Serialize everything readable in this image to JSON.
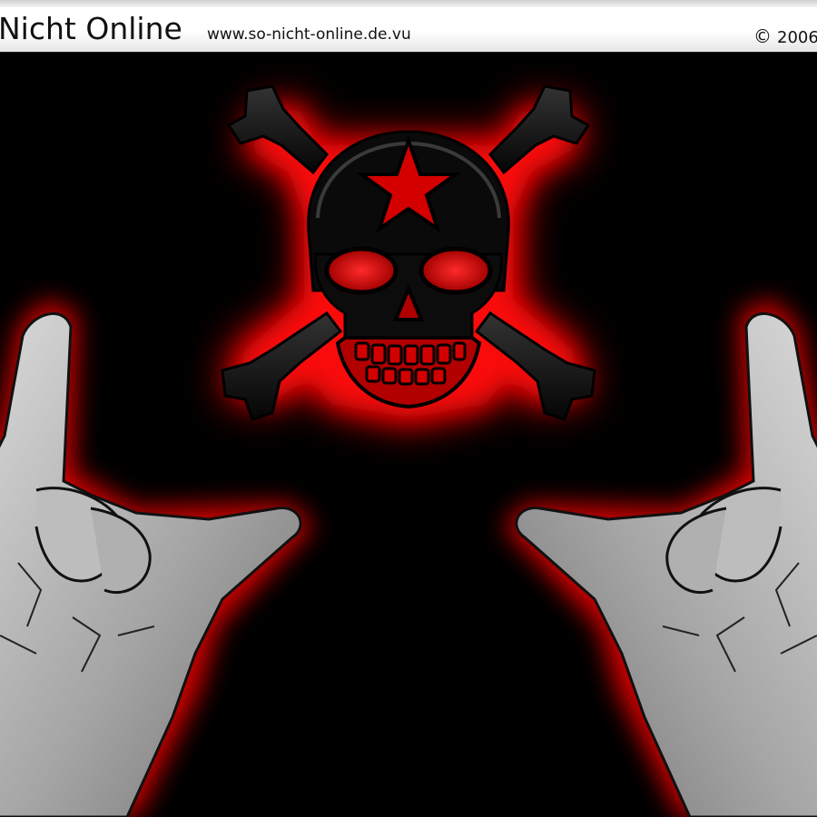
{
  "header": {
    "brand": "Nicht Online",
    "url": "www.so-nicht-online.de.vu",
    "copyright_symbol": "©",
    "year": "2006"
  },
  "colors": {
    "background": "#000000",
    "glow_red": "#d10000",
    "bar": "#ffffff",
    "hand_gray": "#a8a8a8"
  },
  "icons": [
    "skull-crossbones-icon",
    "star-icon",
    "rock-hand-icon"
  ]
}
